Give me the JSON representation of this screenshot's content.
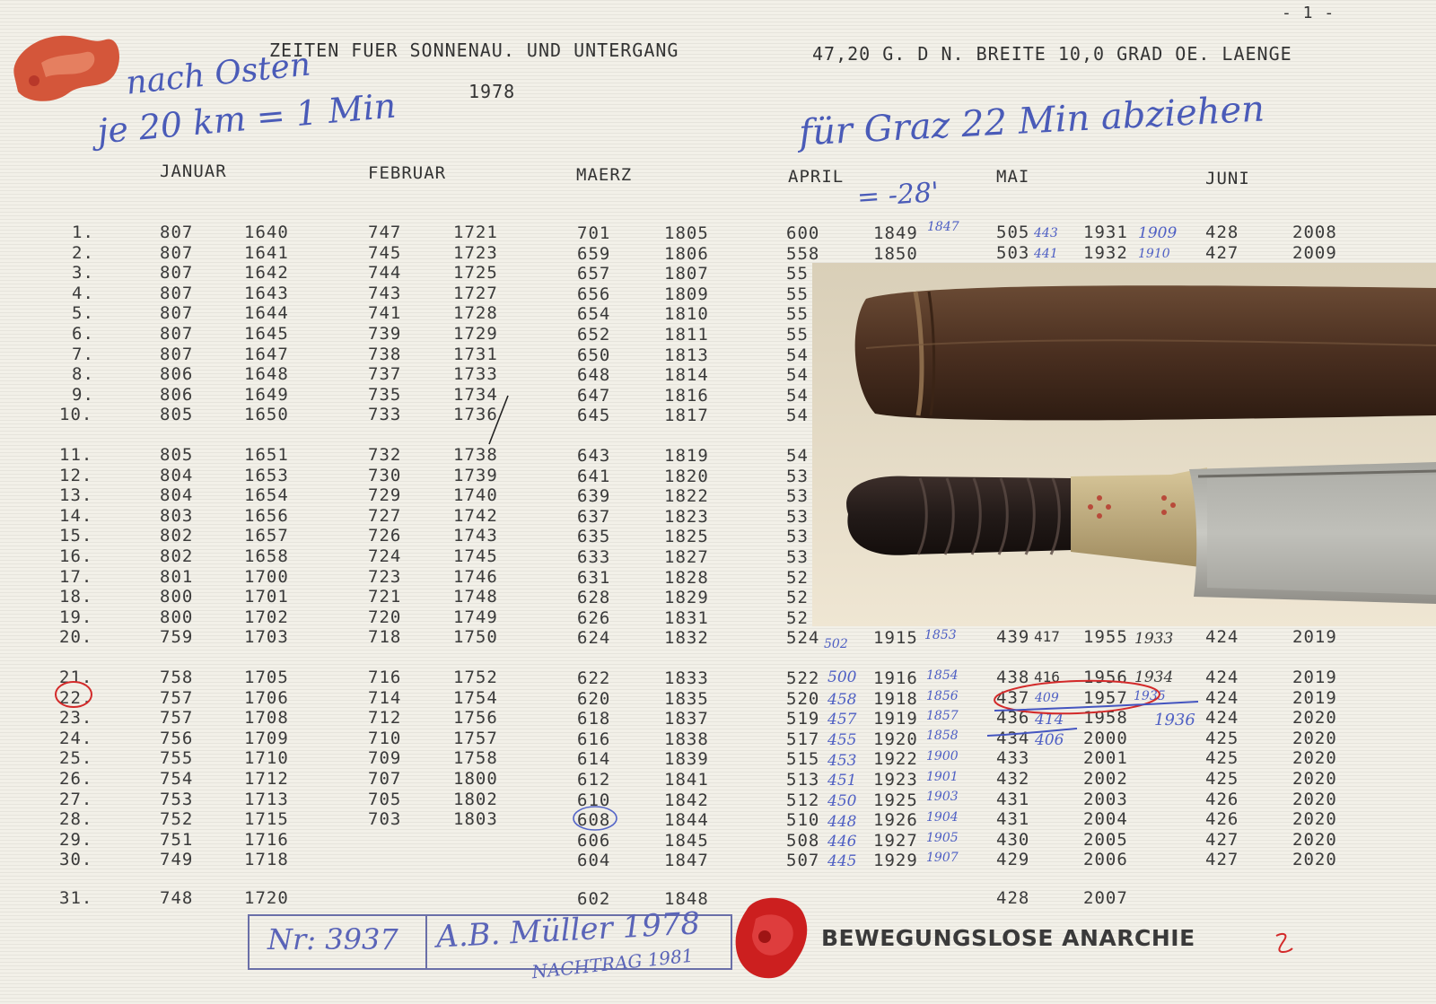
{
  "page_number": "- 1 -",
  "title": {
    "left": "ZEITEN FUER SONNENAU. UND UNTERGANG",
    "right": "47,20 G. D N. BREITE 10,0 GRAD OE. LAENGE",
    "year": "1978"
  },
  "handwriting": {
    "line1": "nach Osten",
    "line2": "je 20 km = 1 Min",
    "line3": "für Graz 22 Min abziehen",
    "line4": "= -28'"
  },
  "months": [
    "JANUAR",
    "FEBRUAR",
    "MAERZ",
    "APRIL",
    "MAI",
    "JUNI"
  ],
  "rows": [
    {
      "day": "1.",
      "jan": [
        "807",
        "1640"
      ],
      "feb": [
        "747",
        "1721"
      ],
      "mar": [
        "701",
        "1805"
      ],
      "apr": [
        "600",
        "1849"
      ],
      "mai": [
        "505",
        "1931"
      ],
      "jun": [
        "428",
        "2008"
      ]
    },
    {
      "day": "2.",
      "jan": [
        "807",
        "1641"
      ],
      "feb": [
        "745",
        "1723"
      ],
      "mar": [
        "659",
        "1806"
      ],
      "apr": [
        "558",
        "1850"
      ],
      "mai": [
        "503",
        "1932"
      ],
      "jun": [
        "427",
        "2009"
      ]
    },
    {
      "day": "3.",
      "jan": [
        "807",
        "1642"
      ],
      "feb": [
        "744",
        "1725"
      ],
      "mar": [
        "657",
        "1807"
      ],
      "apr": [
        "55",
        ""
      ],
      "mai": [
        "",
        ""
      ],
      "jun": [
        "",
        ""
      ]
    },
    {
      "day": "4.",
      "jan": [
        "807",
        "1643"
      ],
      "feb": [
        "743",
        "1727"
      ],
      "mar": [
        "656",
        "1809"
      ],
      "apr": [
        "55",
        ""
      ],
      "mai": [
        "",
        ""
      ],
      "jun": [
        "",
        ""
      ]
    },
    {
      "day": "5.",
      "jan": [
        "807",
        "1644"
      ],
      "feb": [
        "741",
        "1728"
      ],
      "mar": [
        "654",
        "1810"
      ],
      "apr": [
        "55",
        ""
      ],
      "mai": [
        "",
        ""
      ],
      "jun": [
        "",
        ""
      ]
    },
    {
      "day": "6.",
      "jan": [
        "807",
        "1645"
      ],
      "feb": [
        "739",
        "1729"
      ],
      "mar": [
        "652",
        "1811"
      ],
      "apr": [
        "55",
        ""
      ],
      "mai": [
        "",
        ""
      ],
      "jun": [
        "",
        ""
      ]
    },
    {
      "day": "7.",
      "jan": [
        "807",
        "1647"
      ],
      "feb": [
        "738",
        "1731"
      ],
      "mar": [
        "650",
        "1813"
      ],
      "apr": [
        "54",
        ""
      ],
      "mai": [
        "",
        ""
      ],
      "jun": [
        "",
        ""
      ]
    },
    {
      "day": "8.",
      "jan": [
        "806",
        "1648"
      ],
      "feb": [
        "737",
        "1733"
      ],
      "mar": [
        "648",
        "1814"
      ],
      "apr": [
        "54",
        ""
      ],
      "mai": [
        "",
        ""
      ],
      "jun": [
        "",
        ""
      ]
    },
    {
      "day": "9.",
      "jan": [
        "806",
        "1649"
      ],
      "feb": [
        "735",
        "1734"
      ],
      "mar": [
        "647",
        "1816"
      ],
      "apr": [
        "54",
        ""
      ],
      "mai": [
        "",
        ""
      ],
      "jun": [
        "",
        ""
      ]
    },
    {
      "day": "10.",
      "jan": [
        "805",
        "1650"
      ],
      "feb": [
        "733",
        "1736"
      ],
      "mar": [
        "645",
        "1817"
      ],
      "apr": [
        "54",
        ""
      ],
      "mai": [
        "",
        ""
      ],
      "jun": [
        "",
        ""
      ]
    },
    {
      "day": "11.",
      "jan": [
        "805",
        "1651"
      ],
      "feb": [
        "732",
        "1738"
      ],
      "mar": [
        "643",
        "1819"
      ],
      "apr": [
        "54",
        ""
      ],
      "mai": [
        "",
        ""
      ],
      "jun": [
        "",
        ""
      ]
    },
    {
      "day": "12.",
      "jan": [
        "804",
        "1653"
      ],
      "feb": [
        "730",
        "1739"
      ],
      "mar": [
        "641",
        "1820"
      ],
      "apr": [
        "53",
        ""
      ],
      "mai": [
        "",
        ""
      ],
      "jun": [
        "",
        ""
      ]
    },
    {
      "day": "13.",
      "jan": [
        "804",
        "1654"
      ],
      "feb": [
        "729",
        "1740"
      ],
      "mar": [
        "639",
        "1822"
      ],
      "apr": [
        "53",
        ""
      ],
      "mai": [
        "",
        ""
      ],
      "jun": [
        "",
        ""
      ]
    },
    {
      "day": "14.",
      "jan": [
        "803",
        "1656"
      ],
      "feb": [
        "727",
        "1742"
      ],
      "mar": [
        "637",
        "1823"
      ],
      "apr": [
        "53",
        ""
      ],
      "mai": [
        "",
        ""
      ],
      "jun": [
        "",
        ""
      ]
    },
    {
      "day": "15.",
      "jan": [
        "802",
        "1657"
      ],
      "feb": [
        "726",
        "1743"
      ],
      "mar": [
        "635",
        "1825"
      ],
      "apr": [
        "53",
        ""
      ],
      "mai": [
        "",
        ""
      ],
      "jun": [
        "",
        ""
      ]
    },
    {
      "day": "16.",
      "jan": [
        "802",
        "1658"
      ],
      "feb": [
        "724",
        "1745"
      ],
      "mar": [
        "633",
        "1827"
      ],
      "apr": [
        "53",
        ""
      ],
      "mai": [
        "",
        ""
      ],
      "jun": [
        "",
        ""
      ]
    },
    {
      "day": "17.",
      "jan": [
        "801",
        "1700"
      ],
      "feb": [
        "723",
        "1746"
      ],
      "mar": [
        "631",
        "1828"
      ],
      "apr": [
        "52",
        ""
      ],
      "mai": [
        "",
        ""
      ],
      "jun": [
        "",
        ""
      ]
    },
    {
      "day": "18.",
      "jan": [
        "800",
        "1701"
      ],
      "feb": [
        "721",
        "1748"
      ],
      "mar": [
        "628",
        "1829"
      ],
      "apr": [
        "52",
        ""
      ],
      "mai": [
        "",
        ""
      ],
      "jun": [
        "",
        ""
      ]
    },
    {
      "day": "19.",
      "jan": [
        "800",
        "1702"
      ],
      "feb": [
        "720",
        "1749"
      ],
      "mar": [
        "626",
        "1831"
      ],
      "apr": [
        "52",
        ""
      ],
      "mai": [
        "",
        ""
      ],
      "jun": [
        "",
        ""
      ]
    },
    {
      "day": "20.",
      "jan": [
        "759",
        "1703"
      ],
      "feb": [
        "718",
        "1750"
      ],
      "mar": [
        "624",
        "1832"
      ],
      "apr": [
        "524",
        "1915"
      ],
      "mai": [
        "439",
        "1955"
      ],
      "jun": [
        "424",
        "2019"
      ]
    },
    {
      "day": "21.",
      "jan": [
        "758",
        "1705"
      ],
      "feb": [
        "716",
        "1752"
      ],
      "mar": [
        "622",
        "1833"
      ],
      "apr": [
        "522",
        "1916"
      ],
      "mai": [
        "438",
        "1956"
      ],
      "jun": [
        "424",
        "2019"
      ]
    },
    {
      "day": "22.",
      "jan": [
        "757",
        "1706"
      ],
      "feb": [
        "714",
        "1754"
      ],
      "mar": [
        "620",
        "1835"
      ],
      "apr": [
        "520",
        "1918"
      ],
      "mai": [
        "437",
        "1957"
      ],
      "jun": [
        "424",
        "2019"
      ]
    },
    {
      "day": "23.",
      "jan": [
        "757",
        "1708"
      ],
      "feb": [
        "712",
        "1756"
      ],
      "mar": [
        "618",
        "1837"
      ],
      "apr": [
        "519",
        "1919"
      ],
      "mai": [
        "436",
        "1958"
      ],
      "jun": [
        "424",
        "2020"
      ]
    },
    {
      "day": "24.",
      "jan": [
        "756",
        "1709"
      ],
      "feb": [
        "710",
        "1757"
      ],
      "mar": [
        "616",
        "1838"
      ],
      "apr": [
        "517",
        "1920"
      ],
      "mai": [
        "434",
        "2000"
      ],
      "jun": [
        "425",
        "2020"
      ]
    },
    {
      "day": "25.",
      "jan": [
        "755",
        "1710"
      ],
      "feb": [
        "709",
        "1758"
      ],
      "mar": [
        "614",
        "1839"
      ],
      "apr": [
        "515",
        "1922"
      ],
      "mai": [
        "433",
        "2001"
      ],
      "jun": [
        "425",
        "2020"
      ]
    },
    {
      "day": "26.",
      "jan": [
        "754",
        "1712"
      ],
      "feb": [
        "707",
        "1800"
      ],
      "mar": [
        "612",
        "1841"
      ],
      "apr": [
        "513",
        "1923"
      ],
      "mai": [
        "432",
        "2002"
      ],
      "jun": [
        "425",
        "2020"
      ]
    },
    {
      "day": "27.",
      "jan": [
        "753",
        "1713"
      ],
      "feb": [
        "705",
        "1802"
      ],
      "mar": [
        "610",
        "1842"
      ],
      "apr": [
        "512",
        "1925"
      ],
      "mai": [
        "431",
        "2003"
      ],
      "jun": [
        "426",
        "2020"
      ]
    },
    {
      "day": "28.",
      "jan": [
        "752",
        "1715"
      ],
      "feb": [
        "703",
        "1803"
      ],
      "mar": [
        "608",
        "1844"
      ],
      "apr": [
        "510",
        "1926"
      ],
      "mai": [
        "431",
        "2004"
      ],
      "jun": [
        "426",
        "2020"
      ]
    },
    {
      "day": "29.",
      "jan": [
        "751",
        "1716"
      ],
      "feb": [
        "",
        ""
      ],
      "mar": [
        "606",
        "1845"
      ],
      "apr": [
        "508",
        "1927"
      ],
      "mai": [
        "430",
        "2005"
      ],
      "jun": [
        "427",
        "2020"
      ]
    },
    {
      "day": "30.",
      "jan": [
        "749",
        "1718"
      ],
      "feb": [
        "",
        ""
      ],
      "mar": [
        "604",
        "1847"
      ],
      "apr": [
        "507",
        "1929"
      ],
      "mai": [
        "429",
        "2006"
      ],
      "jun": [
        "427",
        "2020"
      ]
    },
    {
      "day": "31.",
      "jan": [
        "748",
        "1720"
      ],
      "feb": [
        "",
        ""
      ],
      "mar": [
        "602",
        "1848"
      ],
      "apr": [
        "",
        ""
      ],
      "mai": [
        "428",
        "2007"
      ],
      "jun": [
        "",
        ""
      ]
    }
  ],
  "annotations": {
    "apr1": "1847",
    "mai1a": "443",
    "mai1b": "1909",
    "mai2a": "441",
    "mai2b": "1910",
    "apr20a": "502",
    "apr20b": "1853",
    "mai20": "417",
    "mai20b": "1933",
    "apr21a": "500",
    "apr21b": "1854",
    "mai21": "416",
    "mai21b": "1934",
    "apr22a": "458",
    "apr22b": "1856",
    "mai22": "409",
    "mai22b": "1935",
    "apr23a": "457",
    "apr23b": "1857",
    "mai23": "414",
    "mai23b": "1936",
    "apr24a": "455",
    "apr24b": "1858",
    "mai24": "406",
    "apr25a": "453",
    "apr25b": "1900",
    "apr26a": "451",
    "apr26b": "1901",
    "apr27a": "450",
    "apr27b": "1903",
    "apr28a": "448",
    "apr28b": "1904",
    "apr29a": "446",
    "apr29b": "1905",
    "apr30a": "445",
    "apr30b": "1907"
  },
  "footer": {
    "number": "Nr: 3937",
    "signature": "A.B. Müller 1978",
    "addendum": "NACHTRAG 1981",
    "brand": "BEWEGUNGSLOSE ANARCHIE"
  },
  "colors": {
    "ink": "#4a5bb8",
    "red_ink": "#d32a2a",
    "wax": "#cc1f1f"
  }
}
